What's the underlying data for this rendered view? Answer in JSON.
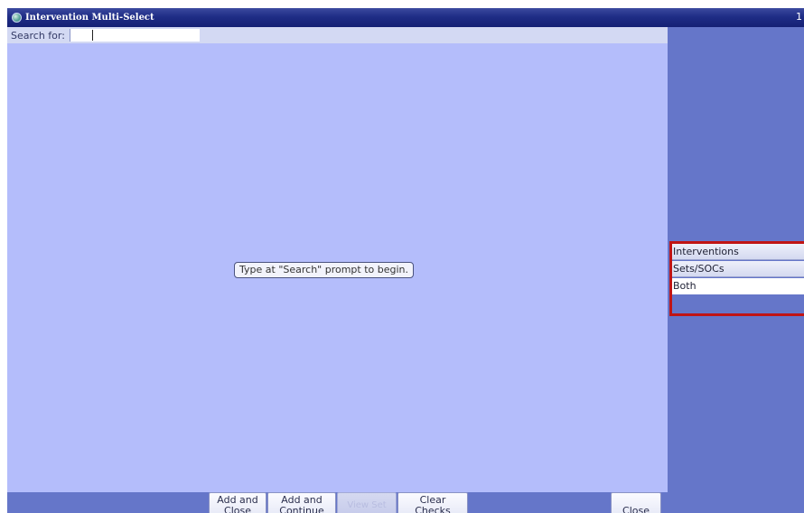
{
  "window": {
    "title": "Intervention Multi-Select",
    "title_right": "1"
  },
  "search": {
    "label": "Search for:",
    "value": ""
  },
  "results": {
    "hint": "Type at \"Search\" prompt to begin."
  },
  "filter": {
    "options": [
      "Interventions",
      "Sets/SOCs",
      "Both"
    ],
    "selected": "Both"
  },
  "buttons": {
    "add_and_close": "Add and\nClose",
    "add_and_continue": "Add and\nContinue",
    "view_set": "View Set",
    "clear_checks": "Clear\nChecks",
    "close": "Close"
  },
  "icons": {
    "title_icon": "app-globe-icon",
    "close_icon": "x-icon"
  },
  "colors": {
    "title_bar": "#1f2d86",
    "results_bg": "#b4bdfb",
    "panel_bg": "#6576c9",
    "highlight_border": "#c01414"
  }
}
